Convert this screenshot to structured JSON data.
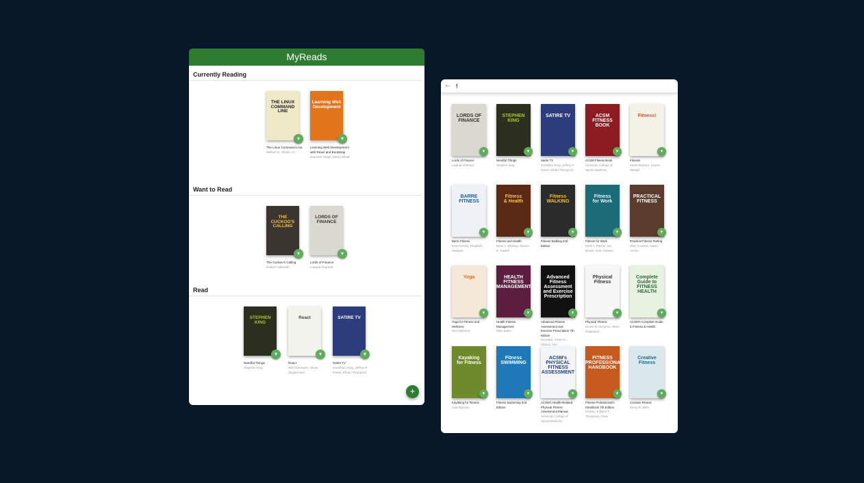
{
  "library": {
    "title": "MyReads",
    "add_button": "+",
    "shelves": [
      {
        "title": "Currently Reading",
        "books": [
          {
            "title": "The Linux Command Line",
            "authors": "William E. Shotts, Jr.",
            "cover_text": "THE LINUX\nCOMMAND LINE",
            "cover_bg": "#efe9c8",
            "cover_fg": "#222"
          },
          {
            "title": "Learning Web Development with React and Bootstrap",
            "authors": "Harmeet Singh, Mehul Bhatt",
            "cover_text": "Learning Web\nDevelopment",
            "cover_bg": "#e2751c",
            "cover_fg": "#fff"
          }
        ]
      },
      {
        "title": "Want to Read",
        "books": [
          {
            "title": "The Cuckoo's Calling",
            "authors": "Robert Galbraith",
            "cover_text": "THE\nCUCKOO'S\nCALLING",
            "cover_bg": "#3b3531",
            "cover_fg": "#f3c14a"
          },
          {
            "title": "Lords of Finance",
            "authors": "Liaquat Ahamed",
            "cover_text": "LORDS OF FINANCE",
            "cover_bg": "#d9d9d1",
            "cover_fg": "#333"
          }
        ]
      },
      {
        "title": "Read",
        "books": [
          {
            "title": "Needful Things",
            "authors": "Stephen King",
            "cover_text": "STEPHEN\nKING",
            "cover_bg": "#2c2f1e",
            "cover_fg": "#a9c334"
          },
          {
            "title": "React",
            "authors": "Nils Hartmann, Oliver Zeigermann",
            "cover_text": "React",
            "cover_bg": "#f3f3ee",
            "cover_fg": "#444"
          },
          {
            "title": "Satire TV",
            "authors": "Jonathan Gray, Jeffrey P. Jones, Ethan Thompson",
            "cover_text": "SATIRE TV",
            "cover_bg": "#2d3c7c",
            "cover_fg": "#fff"
          }
        ]
      }
    ]
  },
  "search": {
    "back_label": "←",
    "query": "f",
    "results": [
      {
        "title": "Lords of Finance",
        "authors": "Liaquat Ahamed",
        "cover_text": "LORDS OF FINANCE",
        "cover_bg": "#d9d9d1",
        "cover_fg": "#333"
      },
      {
        "title": "Needful Things",
        "authors": "Stephen King",
        "cover_text": "STEPHEN\nKING",
        "cover_bg": "#2c2f1e",
        "cover_fg": "#a9c334"
      },
      {
        "title": "Satire TV",
        "authors": "Jonathan Gray, Jeffrey P. Jones, Ethan Thompson",
        "cover_text": "SATIRE TV",
        "cover_bg": "#2d3c7c",
        "cover_fg": "#fff"
      },
      {
        "title": "ACSM Fitness Book",
        "authors": "American College of Sports Medicine",
        "cover_text": "ACSM\nFITNESS BOOK",
        "cover_bg": "#8d1b22",
        "cover_fg": "#fff"
      },
      {
        "title": "Fitness!",
        "authors": "Karen Mazzeo, Lauren Mangili",
        "cover_text": "Fitness!",
        "cover_bg": "#f4f1e6",
        "cover_fg": "#d9532c"
      },
      {
        "title": "Barre Fitness",
        "authors": "Kriss Gerdts, Elizabeth Hallqvist",
        "cover_text": "BARRE\nFITNESS",
        "cover_bg": "#eef1f5",
        "cover_fg": "#1d5fa6"
      },
      {
        "title": "Fitness and Health",
        "authors": "Brian J. Sharkey, Steven E. Gaskill",
        "cover_text": "Fitness\n& Health",
        "cover_bg": "#5a2a16",
        "cover_fg": "#f7c24a"
      },
      {
        "title": "Fitness Walking 2nd Edition",
        "authors": "",
        "cover_text": "Fitness\nWALKING",
        "cover_bg": "#2b2b2b",
        "cover_fg": "#f3c02d"
      },
      {
        "title": "Fitness for Work",
        "authors": "Keith T. Palmer, Ian Brown, John Hobson",
        "cover_text": "Fitness\nfor Work",
        "cover_bg": "#1b6b78",
        "cover_fg": "#e8f4f6"
      },
      {
        "title": "Practical Fitness Testing",
        "authors": "Morc Coulson, David Archer",
        "cover_text": "PRACTICAL\nFITNESS",
        "cover_bg": "#5a3b2e",
        "cover_fg": "#fff"
      },
      {
        "title": "Yoga for Fitness and Wellness",
        "authors": "Ravi Dykema",
        "cover_text": "Yoga",
        "cover_bg": "#f4e9d9",
        "cover_fg": "#d7772c"
      },
      {
        "title": "Health Fitness Management",
        "authors": "Mike Bates",
        "cover_text": "HEALTH\nFITNESS\nMANAGEMENT",
        "cover_bg": "#5c1e3e",
        "cover_fg": "#fff"
      },
      {
        "title": "Advanced Fitness Assessment and Exercise Prescription 7th Edition",
        "authors": "Heyward, Vivian H., Gibson, Ann",
        "cover_text": "Advanced\nFitness Assessment\nand Exercise\nPrescription",
        "cover_bg": "#111111",
        "cover_fg": "#fff"
      },
      {
        "title": "Physical Fitness",
        "authors": "Ernest M. Burgess, Albert Rappoport",
        "cover_text": "Physical\nFitness",
        "cover_bg": "#f7f7f7",
        "cover_fg": "#333"
      },
      {
        "title": "ACSM's Complete Guide to Fitness & Health",
        "authors": "",
        "cover_text": "Complete Guide to\nFITNESS\nHEALTH",
        "cover_bg": "#e9f2e0",
        "cover_fg": "#1f6b36"
      },
      {
        "title": "Kayaking for Fitness",
        "authors": "Jodi Bigelow",
        "cover_text": "Kayaking\nfor Fitness",
        "cover_bg": "#6e8a2c",
        "cover_fg": "#fff"
      },
      {
        "title": "Fitness Swimming 2nd Edition",
        "authors": "",
        "cover_text": "Fitness\nSWIMMING",
        "cover_bg": "#1f79b8",
        "cover_fg": "#fff"
      },
      {
        "title": "ACSM's Health-Related Physical Fitness Assessment Manual",
        "authors": "American College of Sports Medicine",
        "cover_text": "ACSM's\nPHYSICAL FITNESS\nASSESSMENT",
        "cover_bg": "#f3f5f9",
        "cover_fg": "#1d3d7a"
      },
      {
        "title": "Fitness Professional's Handbook 7th Edition",
        "authors": "Howley, Edward T., Thompson, Dixie",
        "cover_text": "FITNESS\nPROFESSIONAL'S\nHANDBOOK",
        "cover_bg": "#c65a1e",
        "cover_fg": "#fff"
      },
      {
        "title": "Creative Fitness",
        "authors": "Henry B. Biller",
        "cover_text": "Creative\nFitness",
        "cover_bg": "#dbe8ee",
        "cover_fg": "#1a6d8a"
      }
    ]
  }
}
